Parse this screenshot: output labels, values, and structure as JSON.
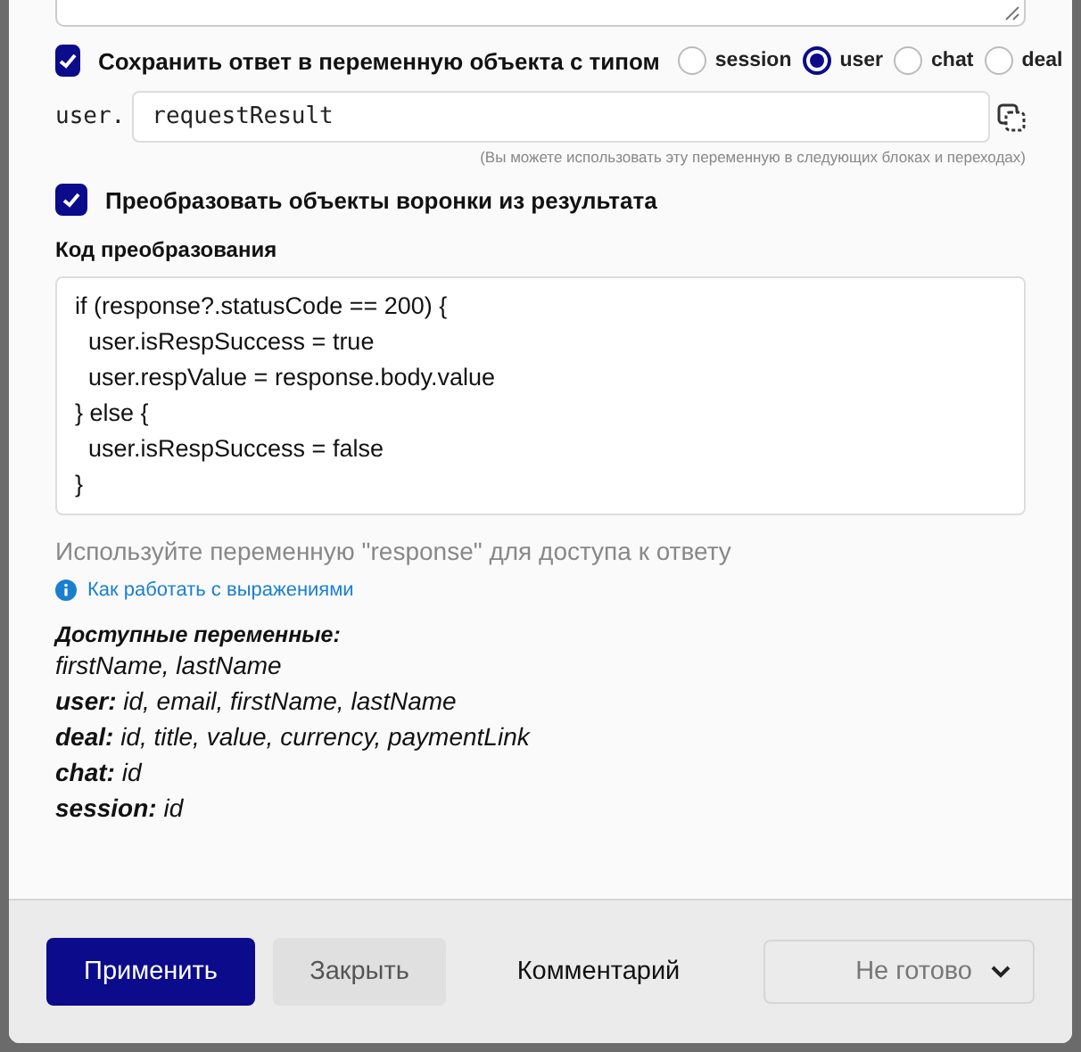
{
  "save_option": {
    "checked": true,
    "label": "Сохранить ответ в переменную объекта с типом"
  },
  "object_types": [
    {
      "label": "session",
      "selected": false
    },
    {
      "label": "user",
      "selected": true
    },
    {
      "label": "chat",
      "selected": false
    },
    {
      "label": "deal",
      "selected": false
    }
  ],
  "variable": {
    "prefix": "user.",
    "value": "requestResult",
    "hint": "(Вы можете использовать эту переменную в следующих блоках и переходах)"
  },
  "transform_option": {
    "checked": true,
    "label": "Преобразовать объекты воронки из результата"
  },
  "code_label": "Код преобразования",
  "code_lines": [
    "if (response?.statusCode == 200) {",
    "  user.isRespSuccess = true",
    "  user.respValue = response.body.value",
    "} else {",
    "  user.isRespSuccess = false",
    "}"
  ],
  "code_hint": "Используйте переменную \"response\" для доступа к ответу",
  "help_link": "Как работать с выражениями",
  "variables_title": "Доступные переменные:",
  "variables": [
    "firstName, lastName",
    "**user:** id, email, firstName, lastName",
    "**deal:** id, title, value, currency, paymentLink",
    "**chat:** id",
    "**session:** id"
  ],
  "footer": {
    "apply": "Применить",
    "close": "Закрыть",
    "comment": "Комментарий",
    "status": "Не готово"
  }
}
